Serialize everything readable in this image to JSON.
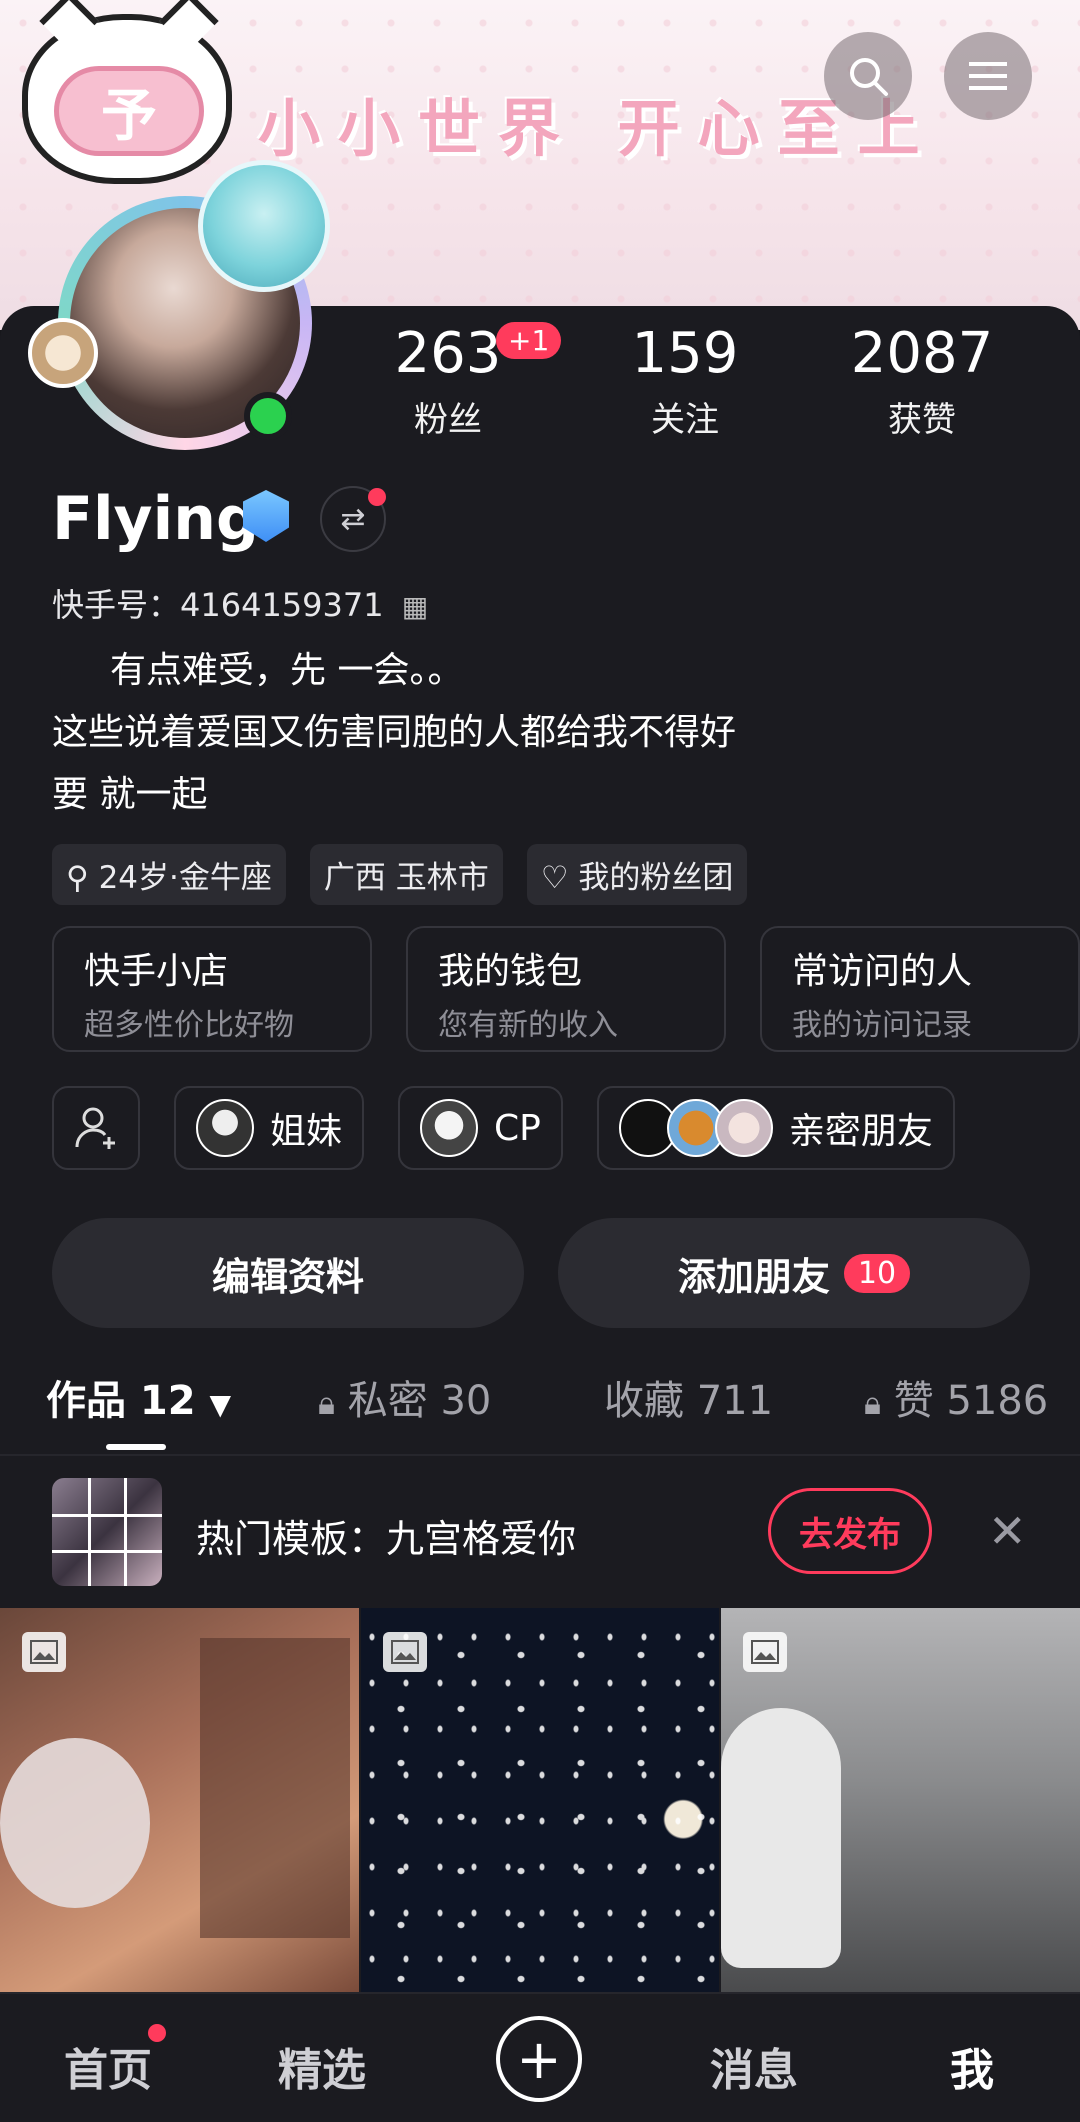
{
  "banner": {
    "text": "小小世界 开心至上",
    "badge_char": "予"
  },
  "stats": [
    {
      "value": "263",
      "label": "粉丝",
      "badge": "+1"
    },
    {
      "value": "159",
      "label": "关注"
    },
    {
      "value": "2087",
      "label": "获赞"
    }
  ],
  "profile": {
    "name": "Flying",
    "kuaishou_id": "快手号：4164159371",
    "bio_lines": [
      "有点难受，先  一会。。",
      "这些说着爱国又伤害同胞的人都给我不得好",
      "要  就一起"
    ]
  },
  "tags": [
    "24岁·金牛座",
    "广西 玉林市",
    "我的粉丝团"
  ],
  "cards": [
    {
      "title": "快手小店",
      "sub": "超多性价比好物"
    },
    {
      "title": "我的钱包",
      "sub": "您有新的收入"
    },
    {
      "title": "常访问的人",
      "sub": "我的访问记录"
    }
  ],
  "friends": [
    "姐妹",
    "CP",
    "亲密朋友"
  ],
  "actions": {
    "edit": "编辑资料",
    "add": "添加朋友",
    "add_count": "10"
  },
  "tabs": [
    {
      "label": "作品 12"
    },
    {
      "label": "私密 30"
    },
    {
      "label": "收藏 711"
    },
    {
      "label": "赞 5186"
    }
  ],
  "promo": {
    "text": "热门模板：九宫格爱你",
    "button": "去发布"
  },
  "navbar": [
    "首页",
    "精选",
    "消息",
    "我"
  ],
  "colors": {
    "accent": "#ff3b5c",
    "online": "#2bd14f",
    "background": "#1b1b20"
  }
}
